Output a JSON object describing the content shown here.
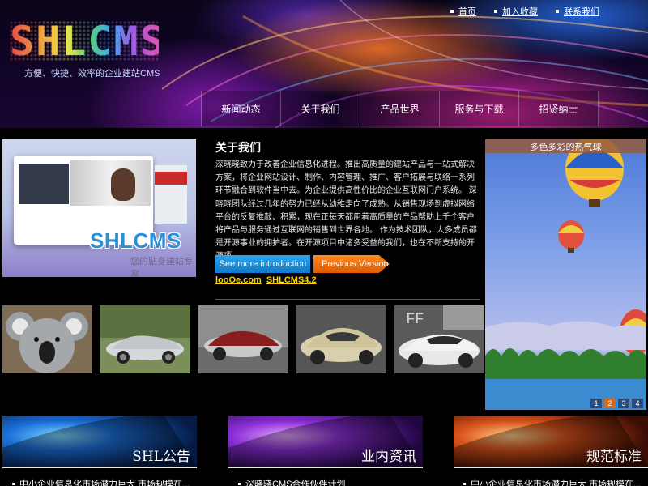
{
  "header": {
    "logo_text": "SHLCMS",
    "tagline": "方便、快捷、效率的企业建站CMS",
    "top_links": [
      "首页",
      "加入收藏",
      "联系我们"
    ]
  },
  "nav": {
    "items": [
      "新闻动态",
      "关于我们",
      "产品世界",
      "服务与下载",
      "招贤纳士"
    ]
  },
  "about": {
    "image_brand": "SHLCMS",
    "image_slogan": "您的贴身建站专家",
    "title": "关于我们",
    "body": "深晓晓致力于改善企业信息化进程。推出高质量的建站产品与一站式解决方案，将企业网站设计、制作、内容管理、推广、客户拓展与联络一系列环节融合到软件当中去。为企业提供高性价比的企业互联网门户系统。 深晓晓团队经过几年的努力已经从幼稚走向了成熟。从销售现场到虚拟网络平台的反复推敲、积累，现在正每天都用着高质量的产品帮助上千个客户将产品与服务通过互联网的销售到世界各地。 作为技术团队，大多成员都是开源事业的拥护者。在开源项目中诸多受益的我们，也在不断支持的开源项...",
    "btn_more": "See more introduction",
    "btn_prev": "Previous Version",
    "link1": "looOe.com",
    "link2": "SHLCMS4.2"
  },
  "thumbnails": [
    "koala",
    "silver-convertible",
    "red-silver-supercar",
    "gold-supercar",
    "white-ferrari"
  ],
  "balloons": {
    "caption": "多色多彩的热气球",
    "pages": [
      "1",
      "2",
      "3",
      "4"
    ],
    "active_page": "2"
  },
  "news": [
    {
      "title": "SHL公告",
      "item": "中小企业信息化市场潜力巨大 市场规模在..."
    },
    {
      "title": "业内资讯",
      "item": "深晓晓CMS合作伙伴计划"
    },
    {
      "title": "规范标准",
      "item": "中小企业信息化市场潜力巨大 市场规模在..."
    }
  ],
  "colors": {
    "link_yellow": "#ffd400",
    "btn_blue": "#1a8fdd",
    "btn_orange": "#f07010",
    "pager_active": "#d2691e"
  }
}
